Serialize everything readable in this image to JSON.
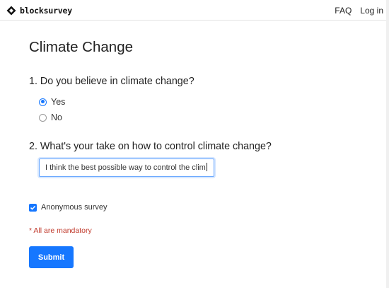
{
  "navbar": {
    "logo_text": "blocksurvey",
    "links": [
      "FAQ",
      "Log in"
    ]
  },
  "survey": {
    "title": "Climate Change",
    "questions": [
      {
        "label": "1. Do you believe in climate change?",
        "options": [
          {
            "label": "Yes",
            "selected": true
          },
          {
            "label": "No",
            "selected": false
          }
        ]
      },
      {
        "label": "2. What's your take on how to control climate change?",
        "answer": "I think the best possible way to control the clim"
      }
    ],
    "anonymous_label": "Anonymous survey",
    "anonymous_checked": true,
    "mandatory_note": "* All are mandatory",
    "submit_label": "Submit"
  },
  "colors": {
    "accent": "#1677ff",
    "mandatory": "#c0392b"
  },
  "icons": {
    "logo": "blocksurvey-logo-icon",
    "checkbox_mark": "check-icon"
  }
}
